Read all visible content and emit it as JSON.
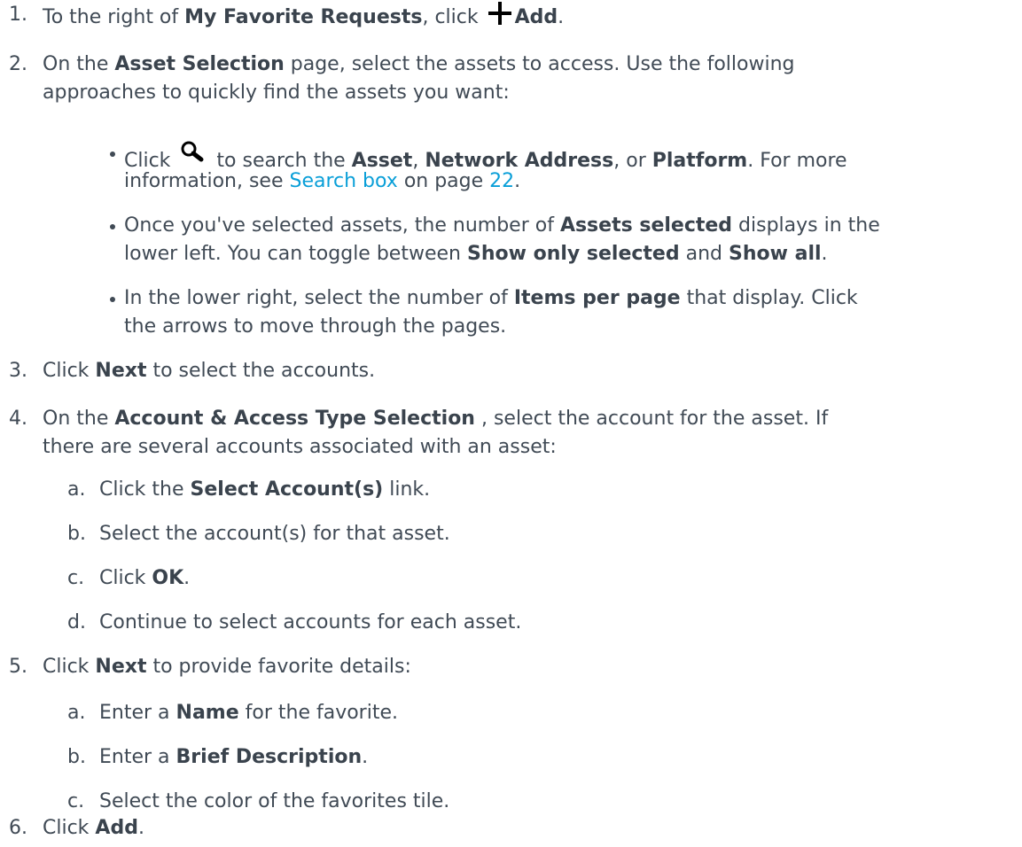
{
  "steps": [
    {
      "num": "1.",
      "parts": [
        "To the right of ",
        "My Favorite Requests",
        ", click ",
        "Add",
        "."
      ]
    },
    {
      "num": "2.",
      "parts": [
        "On the ",
        "Asset Selection",
        " page, select the assets to access. Use the following",
        "approaches to quickly find the assets you want:"
      ]
    },
    {
      "num": "3.",
      "parts": [
        "Click ",
        "Next",
        " to select the accounts."
      ]
    },
    {
      "num": "4.",
      "parts": [
        "On the ",
        "Account & Access Type Selection",
        " , select the account for the asset. If",
        "there are several accounts associated with an asset:"
      ]
    },
    {
      "num": "5.",
      "parts": [
        "Click ",
        "Next",
        " to provide favorite details:"
      ]
    },
    {
      "num": "6.",
      "parts": [
        "Click ",
        "Add",
        "."
      ]
    }
  ],
  "bullets": [
    {
      "parts": [
        "Click ",
        " to search the ",
        "Asset",
        ", ",
        "Network Address",
        ", or ",
        "Platform",
        ". For more",
        "information, see ",
        "Search box",
        " on page ",
        "22",
        "."
      ]
    },
    {
      "parts": [
        "Once you've selected assets, the number of ",
        "Assets selected",
        " displays in the",
        "lower left. You can toggle between ",
        "Show only selected",
        " and ",
        "Show all",
        "."
      ]
    },
    {
      "parts": [
        "In the lower right, select the number of ",
        "Items per page",
        " that display. Click",
        "the arrows to move through the pages."
      ]
    }
  ],
  "substeps4": [
    {
      "letter": "a.",
      "parts": [
        "Click the ",
        "Select Account(s)",
        " link."
      ]
    },
    {
      "letter": "b.",
      "parts": [
        "Select the account(s) for that asset."
      ]
    },
    {
      "letter": "c.",
      "parts": [
        "Click ",
        "OK",
        "."
      ]
    },
    {
      "letter": "d.",
      "parts": [
        "Continue to select accounts for each asset."
      ]
    }
  ],
  "substeps5": [
    {
      "letter": "a.",
      "parts": [
        "Enter a ",
        "Name",
        " for the favorite."
      ]
    },
    {
      "letter": "b.",
      "parts": [
        "Enter a ",
        "Brief Description",
        "."
      ]
    },
    {
      "letter": "c.",
      "parts": [
        "Select the color of the favorites tile."
      ]
    }
  ],
  "icons": {
    "add": "plus-icon",
    "search": "search-icon"
  },
  "colors": {
    "text": "#404a55",
    "link": "#0a9fd8"
  }
}
